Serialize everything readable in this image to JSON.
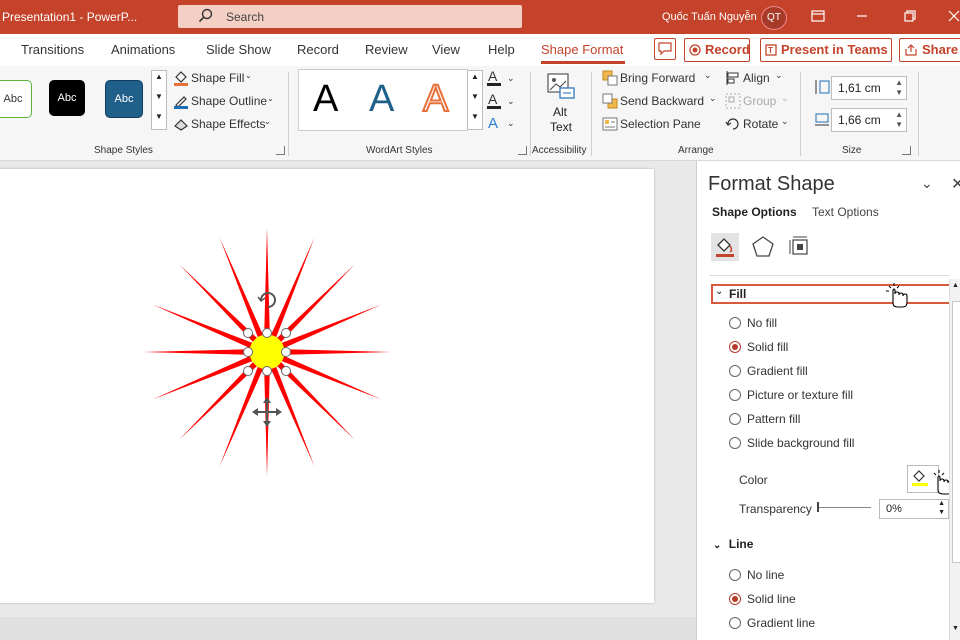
{
  "titlebar": {
    "app_title": "Presentation1  -  PowerP...",
    "search_label": "Search",
    "user_name": "Quốc Tuấn Nguyễn",
    "user_initials": "QT"
  },
  "tabs": [
    {
      "label": "Transitions"
    },
    {
      "label": "Animations"
    },
    {
      "label": "Slide Show"
    },
    {
      "label": "Record"
    },
    {
      "label": "Review"
    },
    {
      "label": "View"
    },
    {
      "label": "Help"
    },
    {
      "label": "Shape Format"
    }
  ],
  "actions": {
    "record_label": "Record",
    "present_label": "Present in Teams",
    "share_label": "Share"
  },
  "ribbon": {
    "shape_styles": {
      "group_label": "Shape Styles",
      "swatches": [
        "Abc",
        "Abc",
        "Abc"
      ],
      "shape_fill": "Shape Fill",
      "shape_outline": "Shape Outline",
      "shape_effects": "Shape Effects"
    },
    "wordart": {
      "group_label": "WordArt Styles",
      "samples": [
        "A",
        "A",
        "A"
      ]
    },
    "accessibility": {
      "group_label": "Accessibility",
      "alt_text_line1": "Alt",
      "alt_text_line2": "Text"
    },
    "arrange": {
      "group_label": "Arrange",
      "bring_forward": "Bring Forward",
      "send_backward": "Send Backward",
      "selection_pane": "Selection Pane",
      "align": "Align",
      "group": "Group",
      "rotate": "Rotate"
    },
    "size": {
      "group_label": "Size",
      "height": "1,61 cm",
      "width": "1,66 cm"
    }
  },
  "format_pane": {
    "title": "Format Shape",
    "tab_shape_options": "Shape Options",
    "tab_text_options": "Text Options",
    "fill_section": "Fill",
    "fill_options": [
      {
        "label": "No fill",
        "selected": false
      },
      {
        "label": "Solid fill",
        "selected": true
      },
      {
        "label": "Gradient fill",
        "selected": false
      },
      {
        "label": "Picture or texture fill",
        "selected": false
      },
      {
        "label": "Pattern fill",
        "selected": false
      },
      {
        "label": "Slide background fill",
        "selected": false
      }
    ],
    "color_label": "Color",
    "transparency_label": "Transparency",
    "transparency_value": "0%",
    "line_section": "Line",
    "line_options": [
      {
        "label": "No line",
        "selected": false
      },
      {
        "label": "Solid line",
        "selected": true
      },
      {
        "label": "Gradient line",
        "selected": false
      }
    ]
  },
  "colors": {
    "accent": "#c4432a",
    "shape_fill": "#ffff00",
    "shape_line": "#ff0000"
  }
}
